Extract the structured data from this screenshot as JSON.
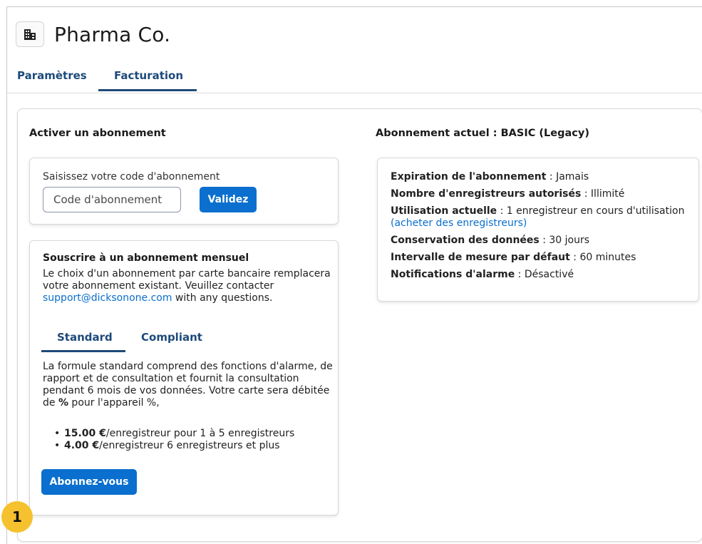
{
  "org": {
    "name": "Pharma Co.",
    "icon": "building-icon"
  },
  "tabs": [
    {
      "label": "Paramètres"
    },
    {
      "label": "Facturation"
    }
  ],
  "activate": {
    "title": "Activer un abonnement",
    "code_label": "Saisissez votre code d'abonnement",
    "code_placeholder": "Code d'abonnement",
    "validate_label": "Validez"
  },
  "monthly": {
    "title": "Souscrire à un abonnement mensuel",
    "desc_before": "Le choix d'un abonnement par carte bancaire remplacera votre abonnement existant. Veuillez contacter ",
    "support_email": "support@dicksonone.com",
    "desc_after": " with any questions.",
    "tabs": [
      {
        "label": "Standard"
      },
      {
        "label": "Compliant"
      }
    ],
    "plan_desc_1": "La formule standard comprend des fonctions d'alarme, de rapport et de consultation et fournit la consultation pendant 6 mois de vos données. Votre carte sera débitée de ",
    "plan_desc_bold": "%",
    "plan_desc_2": " pour l'appareil %,",
    "prices": [
      {
        "amount": "15.00 €",
        "text": "/enregistreur pour 1 à 5 enregistreurs"
      },
      {
        "amount": "4.00 €",
        "text": "/enregistreur 6 enregistreurs et plus"
      }
    ],
    "subscribe_label": "Abonnez-vous"
  },
  "current": {
    "title": "Abonnement actuel : BASIC (Legacy)",
    "lines": [
      {
        "label": "Expiration de l'abonnement",
        "value": " : Jamais"
      },
      {
        "label": "Nombre d'enregistreurs autorisés",
        "value": " : Illimité"
      },
      {
        "label": "Utilisation actuelle",
        "value": " : 1 enregistreur en cours d'utilisation",
        "link": "(acheter des enregistreurs)"
      },
      {
        "label": "Conservation des données",
        "value": " : 30 jours"
      },
      {
        "label": "Intervalle de mesure par défaut",
        "value": " : 60 minutes"
      },
      {
        "label": "Notifications d'alarme",
        "value": " : Désactivé"
      }
    ]
  },
  "marker": {
    "label": "1",
    "color": "#f5c12e"
  },
  "colors": {
    "primary": "#0a6fce",
    "tab": "#1d4a7a"
  }
}
